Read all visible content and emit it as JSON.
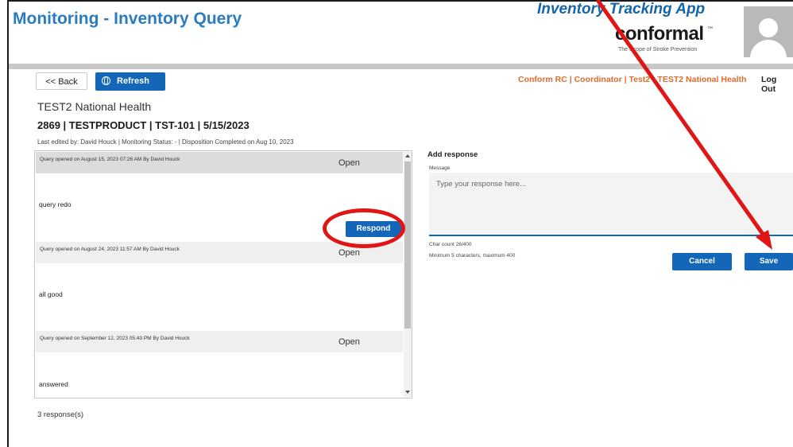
{
  "header": {
    "title": "Monitoring - Inventory Query",
    "app_title": "Inventory Tracking App",
    "logo": {
      "word": "conformal",
      "tm": "™",
      "tagline": "The Scope of Stroke Prevention"
    }
  },
  "toolbar": {
    "back_label": "<< Back",
    "refresh_label": "Refresh",
    "user_info": "Conform RC | Coordinator | Test2 - TEST2 National Health",
    "logout_label": "Log Out"
  },
  "record": {
    "site": "TEST2 National Health",
    "product_line": "2869 | TESTPRODUCT | TST-101 | 5/15/2023",
    "last_edited": "Last edited by: David Houck | Monitoring Status:  -  | Disposition Completed on Aug 10, 2023"
  },
  "queries": [
    {
      "meta": "Query opened on August 15, 2023 07:26 AM By David Houck",
      "status": "Open",
      "body": "query redo",
      "action": "Respond"
    },
    {
      "meta": "Query opened on August 24, 2023 11:57 AM By David Houck",
      "status": "Open",
      "body": "all good"
    },
    {
      "meta": "Query opened on September 12, 2023 05:43 PM By David Houck",
      "status": "Open",
      "body": "answered"
    }
  ],
  "response_count": "3 response(s)",
  "response_form": {
    "heading": "Add response",
    "message_label": "Message",
    "placeholder": "Type your response here...",
    "char_count": "Char count 26/400",
    "hint": "Minimum 5 characters, maximum 400",
    "cancel_label": "Cancel",
    "save_label": "Save"
  },
  "colors": {
    "accent": "#1466b8",
    "title": "#2a7bbf",
    "user_info": "#e06b2b",
    "annotation": "#e01616"
  },
  "icons": [
    "globe-icon",
    "scroll-up-arrow-icon",
    "scroll-down-arrow-icon",
    "avatar-placeholder-icon"
  ]
}
